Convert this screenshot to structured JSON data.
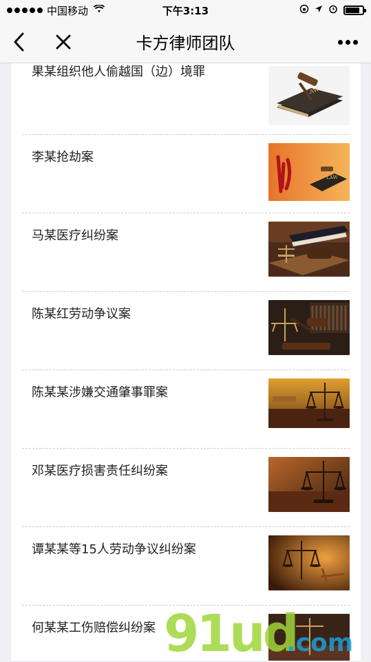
{
  "status_bar": {
    "carrier": "中国移动",
    "time": "下午3:13",
    "battery_level": 0.85
  },
  "nav": {
    "title": "卡方律师团队"
  },
  "cases": [
    {
      "title": "果某组织他人偷越国（边）境罪",
      "thumb": "law-book-gavel"
    },
    {
      "title": "李某抢劫案",
      "thumb": "fa-calligraphy-law-book"
    },
    {
      "title": "马某医疗纠纷案",
      "thumb": "books-gavel-scale"
    },
    {
      "title": "陈某红劳动争议案",
      "thumb": "gavel-bookshelf"
    },
    {
      "title": "陈某某涉嫌交通肇事罪案",
      "thumb": "scales-courtroom"
    },
    {
      "title": "邓某医疗损害责任纠纷案",
      "thumb": "scales-courtroom"
    },
    {
      "title": "谭某某等15人劳动争议纠纷案",
      "thumb": "scales-warm"
    },
    {
      "title": "何某某工伤赔偿纠纷案",
      "thumb": "scales-dark"
    }
  ],
  "watermark": {
    "text_main": "91ud",
    "text_dot": ".com",
    "color_green": "#9fd63a",
    "color_blue": "#1a9ed8"
  }
}
